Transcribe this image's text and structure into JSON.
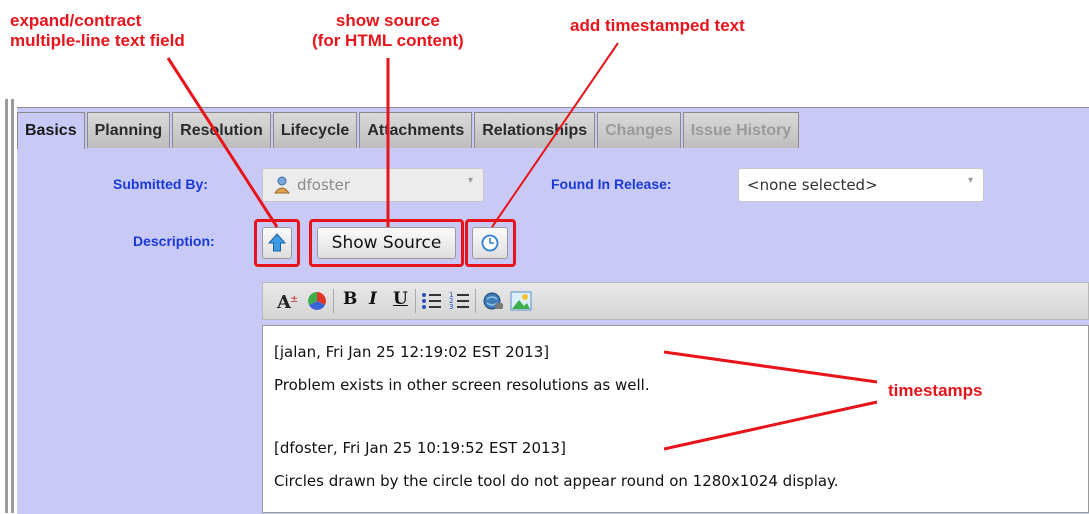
{
  "annotations": {
    "expand": [
      "expand/contract",
      "multiple-line text field"
    ],
    "source": [
      "show source",
      "(for HTML content)"
    ],
    "timestamp_btn": "add timestamped text",
    "timestamps": "timestamps"
  },
  "tabs": [
    {
      "label": "Basics",
      "state": "active"
    },
    {
      "label": "Planning",
      "state": "normal"
    },
    {
      "label": "Resolution",
      "state": "normal"
    },
    {
      "label": "Lifecycle",
      "state": "normal"
    },
    {
      "label": "Attachments",
      "state": "normal"
    },
    {
      "label": "Relationships",
      "state": "normal"
    },
    {
      "label": "Changes",
      "state": "disabled"
    },
    {
      "label": "Issue History",
      "state": "disabled"
    }
  ],
  "form": {
    "submitted_by_label": "Submitted By:",
    "submitted_by_value": "dfoster",
    "found_in_release_label": "Found In Release:",
    "found_in_release_value": "<none selected>",
    "description_label": "Description:",
    "show_source_label": "Show Source"
  },
  "toolbar_icons": [
    "font-size-icon",
    "color-icon",
    "bold-icon",
    "italic-icon",
    "underline-icon",
    "bullet-list-icon",
    "numbered-list-icon",
    "link-icon",
    "image-icon"
  ],
  "editor": {
    "lines": [
      "[jalan, Fri Jan 25 12:19:02 EST 2013]",
      "Problem exists in other screen resolutions as well.",
      "",
      "[dfoster, Fri Jan 25 10:19:52 EST 2013]",
      "Circles drawn by the circle tool do not appear round on 1280x1024 display."
    ]
  },
  "colors": {
    "annotation": "#e8141b",
    "panel_bg": "#c9c9f6",
    "label": "#1a3ad6"
  }
}
